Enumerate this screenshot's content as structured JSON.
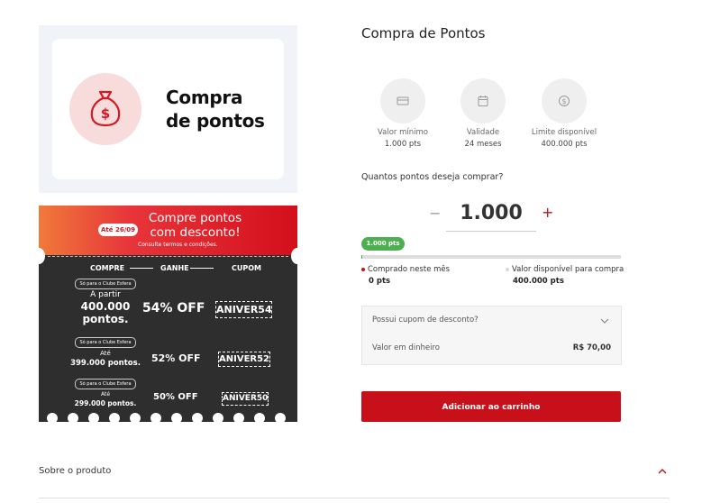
{
  "hero": {
    "title_line1": "Compra",
    "title_line2": "de pontos",
    "icon": "money-bag-icon",
    "accent": "#d21a22"
  },
  "promo": {
    "date": "Até 26/09",
    "headline_line1": "Compre pontos",
    "headline_line2": "com desconto!",
    "terms": "Consulte termos e condições.",
    "columns": [
      "COMPRE",
      "GANHE",
      "CUPOM"
    ],
    "tiers": [
      {
        "badge": "Só para o Clube Esfera",
        "line1": "A partir",
        "line2": "400.000",
        "line3": "pontos.",
        "discount": "54% OFF",
        "code": "ANIVER54"
      },
      {
        "badge": "Só para o Clube Esfera",
        "line1": "Até",
        "line2": "399.000 pontos.",
        "discount": "52% OFF",
        "code": "ANIVER52"
      },
      {
        "badge": "Só para o Clube Esfera",
        "line1": "Até",
        "line2": "299.000 pontos.",
        "discount": "50% OFF",
        "code": "ANIVER50"
      }
    ]
  },
  "page": {
    "title": "Compra de Pontos"
  },
  "info": [
    {
      "icon": "card-icon",
      "label": "Valor mínimo",
      "value": "1.000 pts"
    },
    {
      "icon": "calendar-icon",
      "label": "Validade",
      "value": "24 meses"
    },
    {
      "icon": "coin-icon",
      "label": "Limite disponível",
      "value": "400.000 pts"
    }
  ],
  "quantity": {
    "question": "Quantos pontos deseja comprar?",
    "minus": "−",
    "value": "1.000",
    "plus": "+"
  },
  "progress": {
    "pill": "1.000 pts",
    "fraction": 0.0025,
    "color": "#4caf50",
    "purchased_label": "Comprado neste mês",
    "purchased_value": "0 pts",
    "available_label": "Valor disponível para compra",
    "available_value": "400.000 pts"
  },
  "coupon": {
    "question": "Possui cupom de desconto?",
    "cash_label": "Valor em dinheiro",
    "cash_value": "R$ 70,00"
  },
  "cta": {
    "label": "Adicionar ao carrinho",
    "color": "#c8101a"
  },
  "about": {
    "label": "Sobre o produto"
  }
}
